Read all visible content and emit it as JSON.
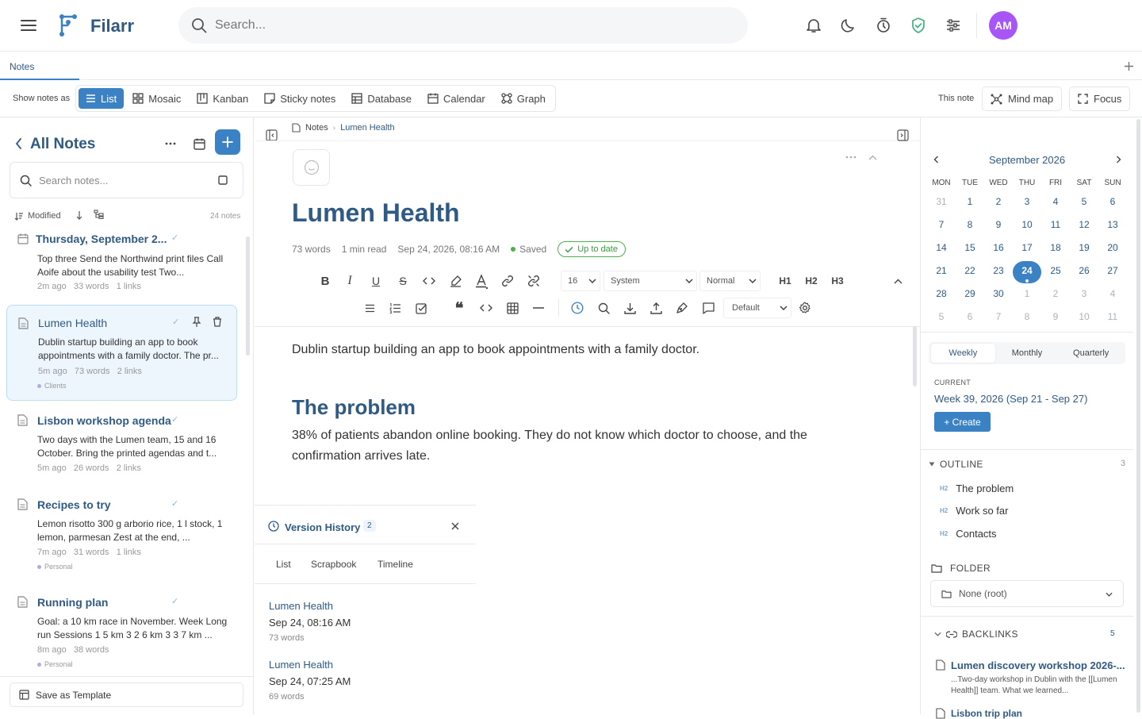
{
  "app": {
    "name": "Filarr",
    "avatar_initials": "AM",
    "accent": "#3b82c4",
    "brand_color": "#2f5a84",
    "avatar_color": "#a855f7"
  },
  "search": {
    "placeholder": "Search..."
  },
  "tabs": [
    {
      "label": "Notes",
      "active": true
    }
  ],
  "view_bar": {
    "label": "Show notes as",
    "views": [
      {
        "label": "List",
        "icon": "list-icon",
        "active": true
      },
      {
        "label": "Mosaic",
        "icon": "grid-icon"
      },
      {
        "label": "Kanban",
        "icon": "kanban-icon"
      },
      {
        "label": "Sticky notes",
        "icon": "sticky-note-icon"
      },
      {
        "label": "Database",
        "icon": "table-icon"
      },
      {
        "label": "Calendar",
        "icon": "calendar-icon"
      },
      {
        "label": "Graph",
        "icon": "graph-icon"
      }
    ],
    "this_note_label": "This note",
    "mind_map_label": "Mind map",
    "focus_label": "Focus"
  },
  "notes_panel": {
    "title": "All Notes",
    "search_placeholder": "Search notes...",
    "sort_label": "Modified",
    "count": "24 notes",
    "save_template_label": "Save as Template",
    "notes": [
      {
        "title": "Thursday, September 2...",
        "snippet": "Top three Send the Northwind print files Call Aoife about the usability test Two...",
        "time": "2m ago",
        "words": "33 words",
        "links": "1 links",
        "tag": ""
      },
      {
        "title": "Lumen Health",
        "snippet": "Dublin startup building an app to book appointments with a family doctor. The pr...",
        "time": "5m ago",
        "words": "73 words",
        "links": "2 links",
        "tag": "Clients"
      },
      {
        "title": "Lisbon workshop agenda",
        "snippet": "Two days with the Lumen team, 15 and 16 October. Bring the printed agendas and t...",
        "time": "5m ago",
        "words": "26 words",
        "links": "2 links",
        "tag": ""
      },
      {
        "title": "Recipes to try",
        "snippet": "Lemon risotto 300 g arborio rice, 1 l stock, 1 lemon, parmesan Zest at the end, ...",
        "time": "7m ago",
        "words": "31 words",
        "links": "1 links",
        "tag": "Personal"
      },
      {
        "title": "Running plan",
        "snippet": "Goal: a 10 km race in November. Week Long run Sessions 1 5 km 3 2 6 km 3 3 7 km ...",
        "time": "8m ago",
        "words": "38 words",
        "links": "",
        "tag": "Personal"
      }
    ]
  },
  "editor": {
    "breadcrumb": [
      "Notes",
      "Lumen Health"
    ],
    "title": "Lumen Health",
    "words": "73 words",
    "read_time": "1 min read",
    "date": "Sep 24, 2026, 08:16 AM",
    "saved_label": "Saved",
    "status_label": "Up to date",
    "font_size": "16",
    "font_family": "System",
    "block_style": "Normal",
    "heading_buttons": [
      "H1",
      "H2",
      "H3"
    ],
    "theme_select": "Default",
    "content": {
      "p1": "Dublin startup building an app to book appointments with a family doctor.",
      "h2_1": "The problem",
      "p2": "38% of patients abandon online booking. They do not know which doctor to choose, and the confirmation arrives late."
    }
  },
  "version_history": {
    "title": "Version History",
    "count": "2",
    "tabs": [
      "List",
      "Scrapbook",
      "Timeline"
    ],
    "entries": [
      {
        "title": "Lumen Health",
        "date": "Sep 24, 08:16 AM",
        "words": "73 words"
      },
      {
        "title": "Lumen Health",
        "date": "Sep 24, 07:25 AM",
        "words": "69 words"
      }
    ]
  },
  "calendar": {
    "month": "September 2026",
    "dow": [
      "MON",
      "TUE",
      "WED",
      "THU",
      "FRI",
      "SAT",
      "SUN"
    ],
    "weeks": [
      [
        "31",
        "1",
        "2",
        "3",
        "4",
        "5",
        "6"
      ],
      [
        "7",
        "8",
        "9",
        "10",
        "11",
        "12",
        "13"
      ],
      [
        "14",
        "15",
        "16",
        "17",
        "18",
        "19",
        "20"
      ],
      [
        "21",
        "22",
        "23",
        "24",
        "25",
        "26",
        "27"
      ],
      [
        "28",
        "29",
        "30",
        "1",
        "2",
        "3",
        "4"
      ],
      [
        "5",
        "6",
        "7",
        "8",
        "9",
        "10",
        "11"
      ]
    ],
    "today": "24",
    "period_tabs": [
      "Weekly",
      "Monthly",
      "Quarterly"
    ],
    "active_period": "Weekly",
    "current_label": "CURRENT",
    "current_week": "Week 39, 2026 (Sep 21 - Sep 27)",
    "create_label": "+ Create"
  },
  "outline": {
    "title": "OUTLINE",
    "count": "3",
    "items": [
      {
        "level": "H2",
        "text": "The problem"
      },
      {
        "level": "H2",
        "text": "Work so far"
      },
      {
        "level": "H2",
        "text": "Contacts"
      }
    ]
  },
  "folder": {
    "title": "FOLDER",
    "value": "None (root)"
  },
  "backlinks": {
    "title": "BACKLINKS",
    "count": "5",
    "items": [
      {
        "title": "Lumen discovery workshop 2026-...",
        "snippet": "...Two-day workshop in Dublin with the [[Lumen Health]] team. What we learned..."
      },
      {
        "title": "Lisbon trip plan",
        "snippet": ""
      }
    ]
  }
}
